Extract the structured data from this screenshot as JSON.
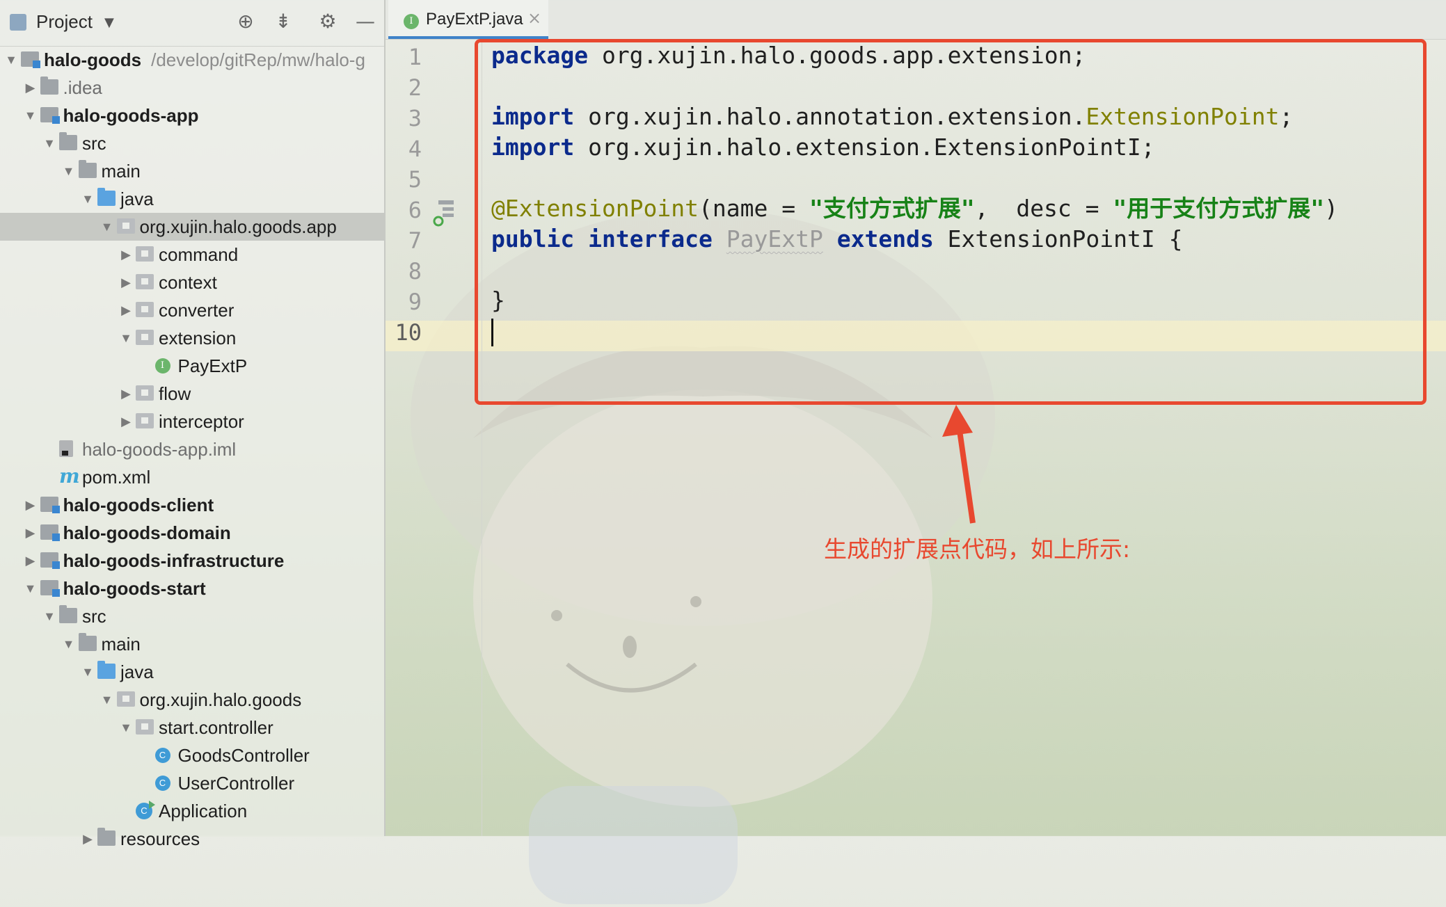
{
  "project_panel": {
    "title": "Project",
    "tree": [
      {
        "indent": 0,
        "arrow": "down",
        "icon": "module",
        "label": "halo-goods",
        "bold": true,
        "extra": "/develop/gitRep/mw/halo-g"
      },
      {
        "indent": 1,
        "arrow": "right",
        "icon": "folder",
        "label": ".idea",
        "gray": true
      },
      {
        "indent": 1,
        "arrow": "down",
        "icon": "module",
        "label": "halo-goods-app",
        "bold": true
      },
      {
        "indent": 2,
        "arrow": "down",
        "icon": "folder",
        "label": "src"
      },
      {
        "indent": 3,
        "arrow": "down",
        "icon": "folder",
        "label": "main"
      },
      {
        "indent": 4,
        "arrow": "down",
        "icon": "folder-blue",
        "label": "java"
      },
      {
        "indent": 5,
        "arrow": "down",
        "icon": "package",
        "label": "org.xujin.halo.goods.app",
        "selected": true
      },
      {
        "indent": 6,
        "arrow": "right",
        "icon": "package",
        "label": "command"
      },
      {
        "indent": 6,
        "arrow": "right",
        "icon": "package",
        "label": "context"
      },
      {
        "indent": 6,
        "arrow": "right",
        "icon": "package",
        "label": "converter"
      },
      {
        "indent": 6,
        "arrow": "down",
        "icon": "package",
        "label": "extension"
      },
      {
        "indent": 7,
        "arrow": "",
        "icon": "iface",
        "label": "PayExtP"
      },
      {
        "indent": 6,
        "arrow": "right",
        "icon": "package",
        "label": "flow"
      },
      {
        "indent": 6,
        "arrow": "right",
        "icon": "package",
        "label": "interceptor"
      },
      {
        "indent": 2,
        "arrow": "",
        "icon": "file",
        "label": "halo-goods-app.iml",
        "gray": true
      },
      {
        "indent": 2,
        "arrow": "",
        "icon": "maven",
        "label": "pom.xml"
      },
      {
        "indent": 1,
        "arrow": "right",
        "icon": "module",
        "label": "halo-goods-client",
        "bold": true
      },
      {
        "indent": 1,
        "arrow": "right",
        "icon": "module",
        "label": "halo-goods-domain",
        "bold": true
      },
      {
        "indent": 1,
        "arrow": "right",
        "icon": "module",
        "label": "halo-goods-infrastructure",
        "bold": true
      },
      {
        "indent": 1,
        "arrow": "down",
        "icon": "module",
        "label": "halo-goods-start",
        "bold": true
      },
      {
        "indent": 2,
        "arrow": "down",
        "icon": "folder",
        "label": "src"
      },
      {
        "indent": 3,
        "arrow": "down",
        "icon": "folder",
        "label": "main"
      },
      {
        "indent": 4,
        "arrow": "down",
        "icon": "folder-blue",
        "label": "java"
      },
      {
        "indent": 5,
        "arrow": "down",
        "icon": "package",
        "label": "org.xujin.halo.goods"
      },
      {
        "indent": 6,
        "arrow": "down",
        "icon": "package",
        "label": "start.controller"
      },
      {
        "indent": 7,
        "arrow": "",
        "icon": "cls",
        "label": "GoodsController"
      },
      {
        "indent": 7,
        "arrow": "",
        "icon": "cls",
        "label": "UserController"
      },
      {
        "indent": 6,
        "arrow": "",
        "icon": "app",
        "label": "Application"
      },
      {
        "indent": 4,
        "arrow": "right",
        "icon": "folder",
        "label": "resources"
      }
    ]
  },
  "editor": {
    "tab": {
      "name": "PayExtP.java",
      "close": "×",
      "icon": "interface-icon"
    },
    "line_numbers": [
      "1",
      "2",
      "3",
      "4",
      "5",
      "6",
      "7",
      "8",
      "9",
      "10"
    ],
    "current_line": 10,
    "code": [
      [
        {
          "t": "package",
          "c": "kw"
        },
        {
          "t": " org.xujin.halo.goods.app.extension;"
        }
      ],
      [],
      [
        {
          "t": "import",
          "c": "kw"
        },
        {
          "t": " org.xujin.halo.annotation.extension."
        },
        {
          "t": "ExtensionPoint",
          "c": "ann"
        },
        {
          "t": ";"
        }
      ],
      [
        {
          "t": "import",
          "c": "kw"
        },
        {
          "t": " org.xujin.halo.extension.ExtensionPointI;"
        }
      ],
      [],
      [
        {
          "t": "@ExtensionPoint",
          "c": "ann"
        },
        {
          "t": "(name = "
        },
        {
          "t": "\"支付方式扩展\"",
          "c": "str"
        },
        {
          "t": ",  desc = "
        },
        {
          "t": "\"用于支付方式扩展\"",
          "c": "str"
        },
        {
          "t": ")"
        }
      ],
      [
        {
          "t": "public",
          "c": "kw"
        },
        {
          "t": " "
        },
        {
          "t": "interface",
          "c": "kw"
        },
        {
          "t": " "
        },
        {
          "t": "PayExtP",
          "c": "unused"
        },
        {
          "t": " "
        },
        {
          "t": "extends",
          "c": "kw"
        },
        {
          "t": " ExtensionPointI {"
        }
      ],
      [],
      [
        {
          "t": "}"
        }
      ],
      [
        {
          "caret": true
        }
      ]
    ]
  },
  "annotation": {
    "text": "生成的扩展点代码，如上所示:",
    "color": "#e8482f"
  },
  "colors": {
    "keyword": "#0b2a8c",
    "annotation": "#808000",
    "string": "#178217",
    "accent": "#e8482f"
  }
}
